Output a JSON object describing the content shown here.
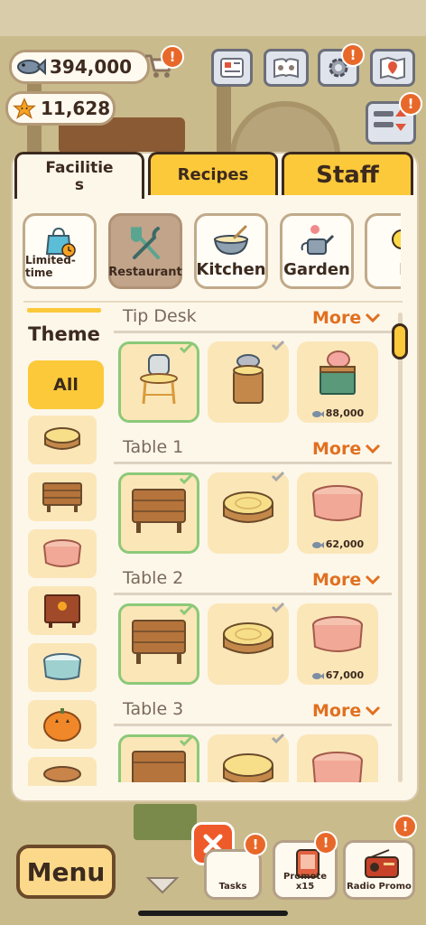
{
  "hud": {
    "fish_amount": "394,000",
    "star_amount": "11,628",
    "alert_mark": "!"
  },
  "tabs": [
    {
      "label": "Facilitie\ns",
      "active": true
    },
    {
      "label": "Recipes",
      "active": false
    },
    {
      "label": "Staff",
      "active": false
    }
  ],
  "categories": [
    {
      "label": "Limited-time",
      "icon": "shopping-bag-clock-icon"
    },
    {
      "label": "Restaurant",
      "icon": "utensils-icon",
      "active": true
    },
    {
      "label": "Kitchen",
      "icon": "mixing-bowl-icon"
    },
    {
      "label": "Garden",
      "icon": "watering-can-icon"
    },
    {
      "label": "Bu",
      "icon": "bulb-icon"
    }
  ],
  "theme": {
    "title": "Theme",
    "all_label": "All"
  },
  "sections": [
    {
      "title": "Tip Desk",
      "more": "More",
      "items": [
        {
          "name": "jar-tip-desk",
          "owned": true,
          "selected": true
        },
        {
          "name": "stump-tip-desk",
          "owned": true,
          "selected": false
        },
        {
          "name": "piggy-bank-desk",
          "owned": false,
          "price": "88,000"
        }
      ]
    },
    {
      "title": "Table 1",
      "more": "More",
      "items": [
        {
          "name": "wood-plank-table",
          "owned": true,
          "selected": true
        },
        {
          "name": "log-stump-table",
          "owned": true,
          "selected": false
        },
        {
          "name": "gingham-table",
          "owned": false,
          "price": "62,000"
        }
      ]
    },
    {
      "title": "Table 2",
      "more": "More",
      "items": [
        {
          "name": "wood-plank-table",
          "owned": true,
          "selected": true
        },
        {
          "name": "log-stump-table",
          "owned": true,
          "selected": false
        },
        {
          "name": "gingham-table",
          "owned": false,
          "price": "67,000"
        }
      ]
    },
    {
      "title": "Table 3",
      "more": "More",
      "items": [
        {
          "name": "wood-plank-table",
          "owned": true,
          "selected": true
        },
        {
          "name": "log-stump-table",
          "owned": true,
          "selected": false
        },
        {
          "name": "gingham-table",
          "owned": false
        }
      ]
    }
  ],
  "bottom": {
    "menu_label": "Menu",
    "tasks_label": "Tasks",
    "promote_label": "Promote x15",
    "radio_label": "Radio Promo"
  },
  "colors": {
    "accent_yellow": "#fcc93b",
    "more_orange": "#e07020",
    "owned_green": "#8cc978"
  }
}
